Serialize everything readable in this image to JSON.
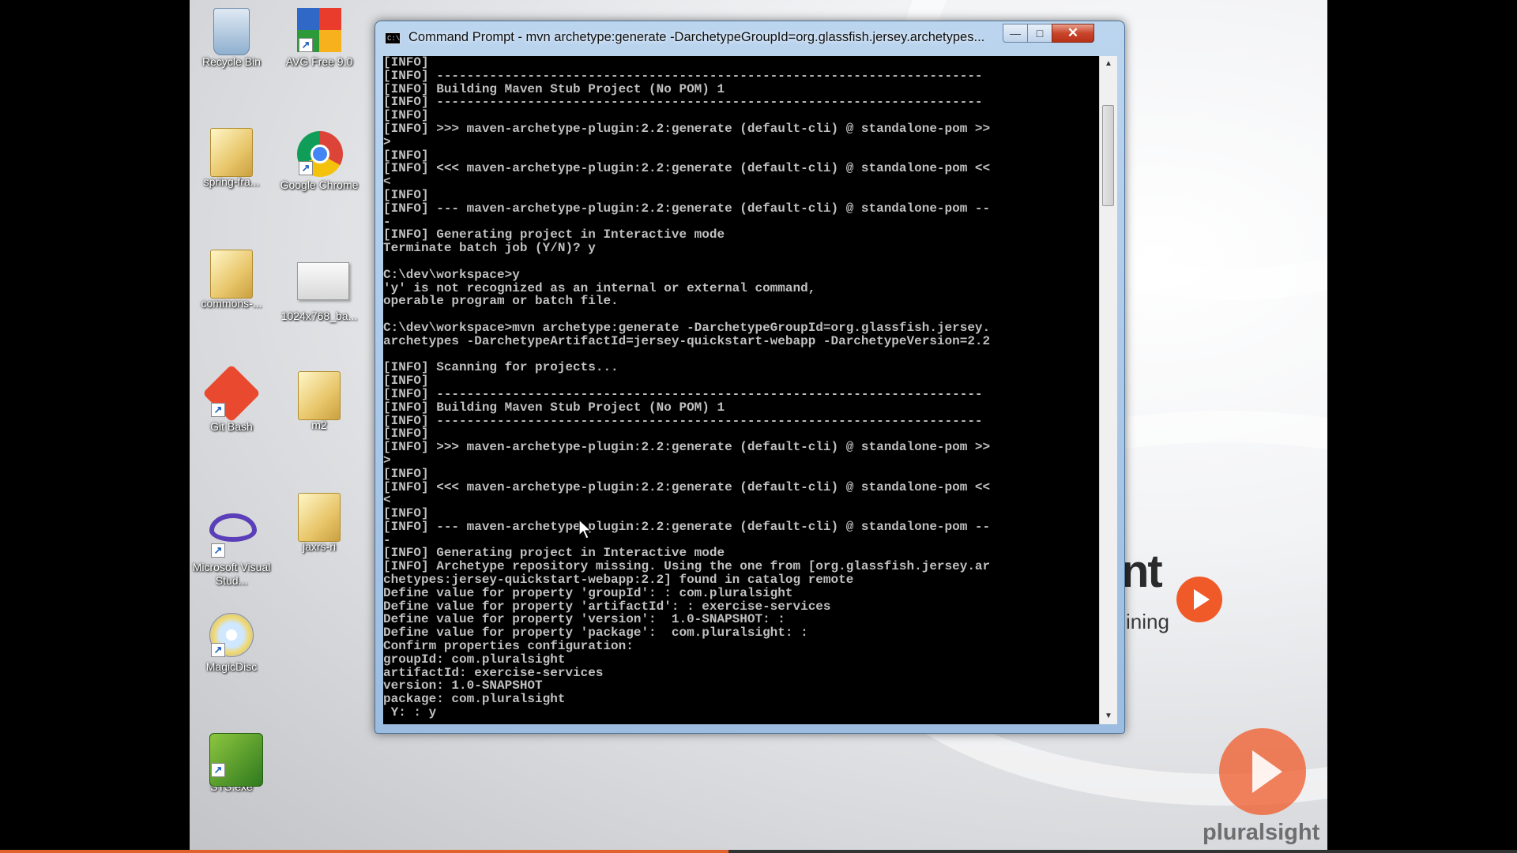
{
  "desktop_icons": [
    {
      "label": "Recycle Bin",
      "icon": "recycle-bin-icon"
    },
    {
      "label": "AVG Free 9.0",
      "icon": "avg-icon"
    },
    {
      "label": "spring-fra...",
      "icon": "folder-icon"
    },
    {
      "label": "Google Chrome",
      "icon": "chrome-icon"
    },
    {
      "label": "commons-...",
      "icon": "folder-icon"
    },
    {
      "label": "1024x768_ba...",
      "icon": "image-file-icon"
    },
    {
      "label": "Git Bash",
      "icon": "git-bash-icon"
    },
    {
      "label": "m2",
      "icon": "folder-icon"
    },
    {
      "label": "Microsoft Visual Stud...",
      "icon": "visual-studio-icon"
    },
    {
      "label": "jaxrs-ri",
      "icon": "folder-icon"
    },
    {
      "label": "MagicDisc",
      "icon": "magicdisc-icon"
    },
    {
      "label": "STS.exe",
      "icon": "sts-icon"
    }
  ],
  "window": {
    "title": "Command Prompt - mvn  archetype:generate -DarchetypeGroupId=org.glassfish.jersey.archetypes...",
    "minimize": "—",
    "maximize": "□",
    "close": "✕"
  },
  "console_lines": [
    "[INFO]",
    "[INFO] ------------------------------------------------------------------------",
    "[INFO] Building Maven Stub Project (No POM) 1",
    "[INFO] ------------------------------------------------------------------------",
    "[INFO]",
    "[INFO] >>> maven-archetype-plugin:2.2:generate (default-cli) @ standalone-pom >>",
    ">",
    "[INFO]",
    "[INFO] <<< maven-archetype-plugin:2.2:generate (default-cli) @ standalone-pom <<",
    "<",
    "[INFO]",
    "[INFO] --- maven-archetype-plugin:2.2:generate (default-cli) @ standalone-pom --",
    "-",
    "[INFO] Generating project in Interactive mode",
    "Terminate batch job (Y/N)? y",
    "",
    "C:\\dev\\workspace>y",
    "'y' is not recognized as an internal or external command,",
    "operable program or batch file.",
    "",
    "C:\\dev\\workspace>mvn archetype:generate -DarchetypeGroupId=org.glassfish.jersey.",
    "archetypes -DarchetypeArtifactId=jersey-quickstart-webapp -DarchetypeVersion=2.2",
    "",
    "[INFO] Scanning for projects...",
    "[INFO]",
    "[INFO] ------------------------------------------------------------------------",
    "[INFO] Building Maven Stub Project (No POM) 1",
    "[INFO] ------------------------------------------------------------------------",
    "[INFO]",
    "[INFO] >>> maven-archetype-plugin:2.2:generate (default-cli) @ standalone-pom >>",
    ">",
    "[INFO]",
    "[INFO] <<< maven-archetype-plugin:2.2:generate (default-cli) @ standalone-pom <<",
    "<",
    "[INFO]",
    "[INFO] --- maven-archetype-plugin:2.2:generate (default-cli) @ standalone-pom --",
    "-",
    "[INFO] Generating project in Interactive mode",
    "[INFO] Archetype repository missing. Using the one from [org.glassfish.jersey.ar",
    "chetypes:jersey-quickstart-webapp:2.2] found in catalog remote",
    "Define value for property 'groupId': : com.pluralsight",
    "Define value for property 'artifactId': : exercise-services",
    "Define value for property 'version':  1.0-SNAPSHOT: :",
    "Define value for property 'package':  com.pluralsight: :",
    "Confirm properties configuration:",
    "groupId: com.pluralsight",
    "artifactId: exercise-services",
    "version: 1.0-SNAPSHOT",
    "package: com.pluralsight",
    " Y: : y"
  ],
  "scrollbar": {
    "up": "▲",
    "down": "▼"
  },
  "brand": {
    "partial_big": "nt",
    "partial_small": "ining",
    "logo_text": "pluralsight"
  },
  "video_progress": 0.48,
  "colors": {
    "console_bg": "#000000",
    "console_text": "#c0c0c0",
    "brand_orange": "#f05a28"
  }
}
